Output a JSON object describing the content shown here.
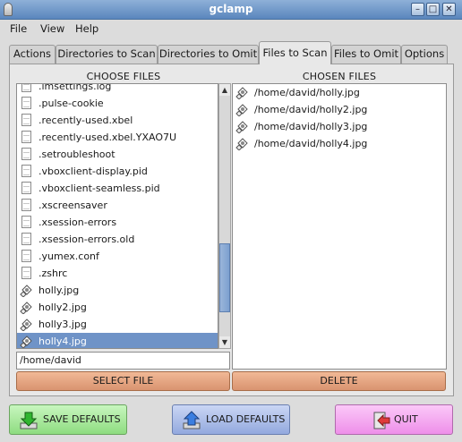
{
  "window": {
    "title": "gclamp"
  },
  "menu": [
    "File",
    "View",
    "Help"
  ],
  "tabs": [
    "Actions",
    "Directories to Scan",
    "Directories to Omit",
    "Files to Scan",
    "Files to Omit",
    "Options"
  ],
  "active_tab": "Files to Scan",
  "choose": {
    "heading": "CHOOSE FILES",
    "items": [
      {
        "name": ".imsettings.log",
        "icon": "document-icon"
      },
      {
        "name": ".pulse-cookie",
        "icon": "document-icon"
      },
      {
        "name": ".recently-used.xbel",
        "icon": "document-icon"
      },
      {
        "name": ".recently-used.xbel.YXAO7U",
        "icon": "document-icon"
      },
      {
        "name": ".setroubleshoot",
        "icon": "document-icon"
      },
      {
        "name": ".vboxclient-display.pid",
        "icon": "document-icon"
      },
      {
        "name": ".vboxclient-seamless.pid",
        "icon": "document-icon"
      },
      {
        "name": ".xscreensaver",
        "icon": "document-icon"
      },
      {
        "name": ".xsession-errors",
        "icon": "document-icon"
      },
      {
        "name": ".xsession-errors.old",
        "icon": "document-icon"
      },
      {
        "name": ".yumex.conf",
        "icon": "document-icon"
      },
      {
        "name": ".zshrc",
        "icon": "document-icon"
      },
      {
        "name": "holly.jpg",
        "icon": "image-file-icon"
      },
      {
        "name": "holly2.jpg",
        "icon": "image-file-icon"
      },
      {
        "name": "holly3.jpg",
        "icon": "image-file-icon"
      },
      {
        "name": "holly4.jpg",
        "icon": "image-file-icon",
        "selected": true
      }
    ],
    "scroll_fraction": 0.86,
    "path_value": "/home/david",
    "select_button": "SELECT FILE"
  },
  "chosen": {
    "heading": "CHOSEN FILES",
    "items": [
      "/home/david/holly.jpg",
      "/home/david/holly2.jpg",
      "/home/david/holly3.jpg",
      "/home/david/holly4.jpg"
    ],
    "delete_button": "DELETE"
  },
  "footer": {
    "save": "SAVE DEFAULTS",
    "load": "LOAD DEFAULTS",
    "quit": "QUIT"
  },
  "colors": {
    "selection": "#6f93c7",
    "save_button": "#a8e99a",
    "load_button": "#a9bce9",
    "quit_button": "#f3a5f0",
    "action_button": "#e3a27f"
  }
}
